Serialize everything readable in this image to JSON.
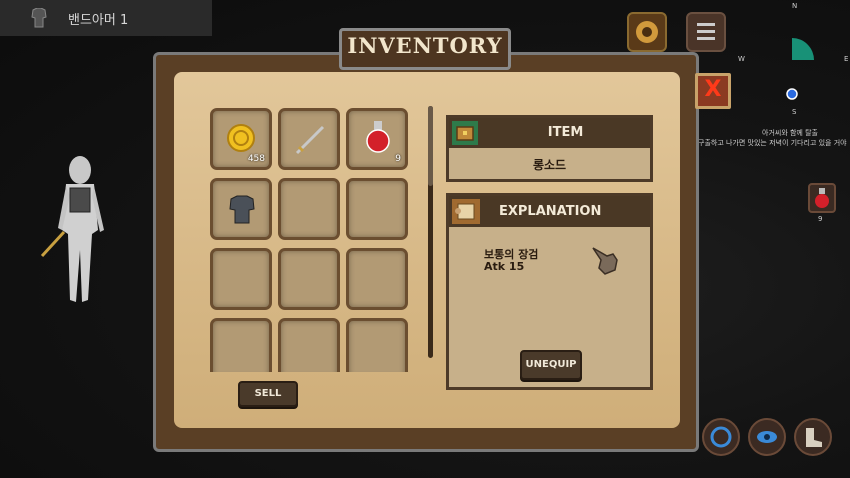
{
  "player": {
    "name": "밴드아머 1"
  },
  "panel": {
    "title": "INVENTORY",
    "close_label": "X"
  },
  "inventory": {
    "slots": [
      {
        "name": "gold-coin",
        "icon": "gold-coin-icon",
        "count": "458"
      },
      {
        "name": "long-sword",
        "icon": "sword-icon",
        "count": ""
      },
      {
        "name": "red-potion",
        "icon": "red-potion-icon",
        "count": "9"
      },
      {
        "name": "band-armor",
        "icon": "armor-icon",
        "count": ""
      },
      {
        "name": "empty",
        "icon": "",
        "count": ""
      },
      {
        "name": "empty",
        "icon": "",
        "count": ""
      },
      {
        "name": "empty",
        "icon": "",
        "count": ""
      },
      {
        "name": "empty",
        "icon": "",
        "count": ""
      },
      {
        "name": "empty",
        "icon": "",
        "count": ""
      },
      {
        "name": "empty",
        "icon": "",
        "count": ""
      },
      {
        "name": "empty",
        "icon": "",
        "count": ""
      },
      {
        "name": "empty",
        "icon": "",
        "count": ""
      }
    ],
    "sell_label": "SELL"
  },
  "item": {
    "header": "ITEM",
    "name": "롱소드"
  },
  "explanation": {
    "header": "EXPLANATION",
    "line1": "보통의 장검",
    "line2": "Atk 15",
    "unequip_label": "UNEQUIP"
  },
  "minimap": {
    "north": "N",
    "west": "W",
    "east": "E",
    "south": "S"
  },
  "quest": {
    "line1": "아거씨와 함께 탈출",
    "line2": "구출하고 나가면 맛있는 저녁이 기다리고 있을 거야"
  },
  "quick_slot": {
    "potion_count": "9"
  },
  "colors": {
    "parchment": "#d6b785",
    "frame": "#5a3f25",
    "header": "#4a3825",
    "close": "#ff3a1a"
  }
}
